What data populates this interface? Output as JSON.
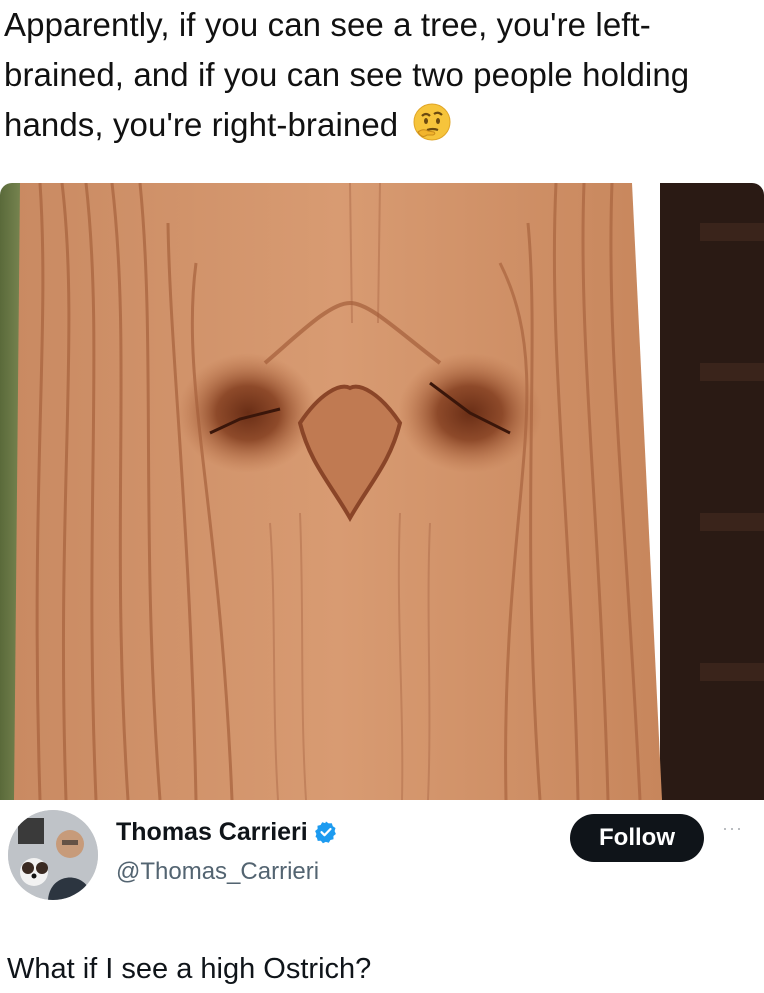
{
  "caption": {
    "text": "Apparently, if you can see a tree, you're left-brained, and if you can see two people holding hands, you're right-brained",
    "emoji": "thinking-face-emoji"
  },
  "photo": {
    "subject": "wood-plank-knot-illusion"
  },
  "tweet": {
    "display_name": "Thomas Carrieri",
    "handle": "@Thomas_Carrieri",
    "follow_label": "Follow",
    "more_label": "···",
    "text": "What if I see a high Ostrich?",
    "verified_icon": "verified-badge-icon",
    "accent_color": "#1d9bf0"
  },
  "colors": {
    "wood": "#c8855a",
    "wood_dark": "#8a4a2a",
    "button_bg": "#0f1419"
  }
}
